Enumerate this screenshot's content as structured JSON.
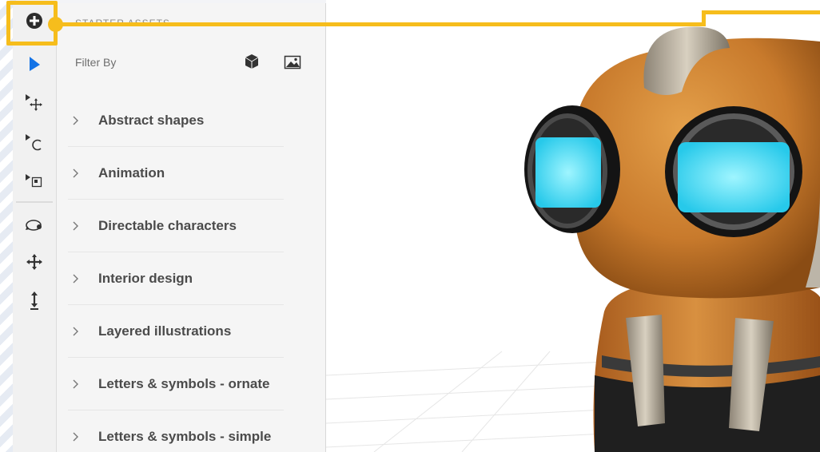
{
  "panel": {
    "title": "STARTER ASSETS",
    "filter_label": "Filter By",
    "filters": [
      "cube-icon",
      "image-icon"
    ],
    "items": [
      {
        "label": "Abstract shapes"
      },
      {
        "label": "Animation"
      },
      {
        "label": "Directable characters"
      },
      {
        "label": "Interior design"
      },
      {
        "label": "Layered illustrations"
      },
      {
        "label": "Letters & symbols - ornate"
      },
      {
        "label": "Letters & symbols - simple"
      }
    ]
  },
  "toolbar": {
    "tools": [
      "add-icon",
      "select-icon",
      "move-icon",
      "rotate-icon",
      "scale-icon",
      "orbit-icon",
      "pan-icon",
      "dolly-icon"
    ]
  },
  "colors": {
    "accent": "#f6bd1c",
    "select_blue": "#1473e6",
    "text": "#4b4b4b"
  }
}
